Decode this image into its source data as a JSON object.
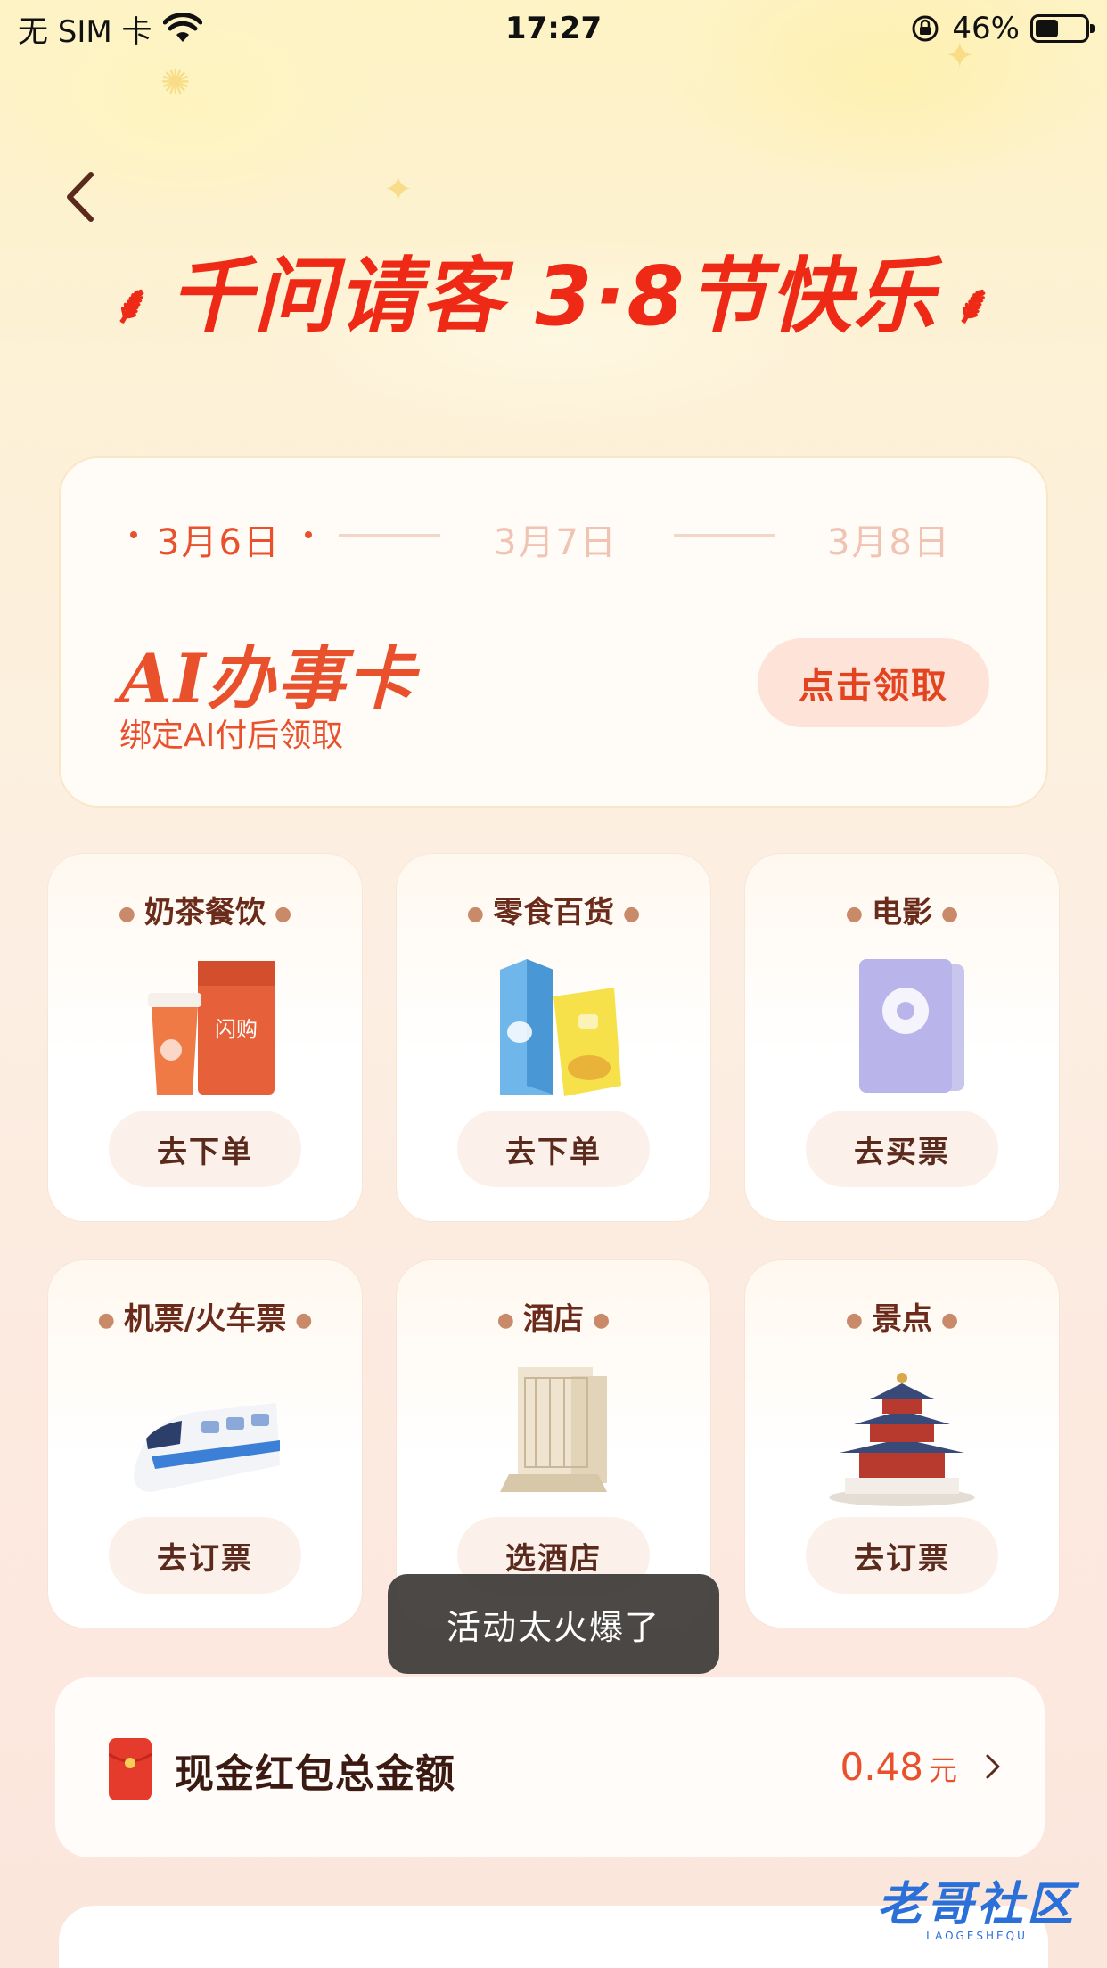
{
  "status_bar": {
    "carrier": "无 SIM 卡",
    "time": "17:27",
    "battery": "46%",
    "battery_level": 0.46
  },
  "header": {
    "title_left": "千问请客",
    "title_right": "3·8节快乐"
  },
  "ai_card": {
    "dates": [
      "3月6日",
      "3月7日",
      "3月8日"
    ],
    "active_date_index": 0,
    "title": "AI办事卡",
    "subtitle": "绑定AI付后领取",
    "button": "点击领取"
  },
  "services": [
    {
      "title": "奶茶餐饮",
      "button": "去下单",
      "icon": "milk-tea-bag-icon"
    },
    {
      "title": "零食百货",
      "button": "去下单",
      "icon": "snack-icon"
    },
    {
      "title": "电影",
      "button": "去买票",
      "icon": "movie-ticket-icon"
    },
    {
      "title": "机票/火车票",
      "button": "去订票",
      "icon": "train-icon"
    },
    {
      "title": "酒店",
      "button": "选酒店",
      "icon": "hotel-icon"
    },
    {
      "title": "景点",
      "button": "去订票",
      "icon": "temple-icon"
    }
  ],
  "toast": "活动太火爆了",
  "cash": {
    "label": "现金红包总金额",
    "amount": "0.48",
    "unit": "元"
  },
  "watermark": {
    "cn": "老哥社区",
    "en": "LAOGESHEQU"
  },
  "colors": {
    "accent": "#e8512c",
    "title_red": "#ee2a16",
    "brown_text": "#6b2b1b"
  }
}
